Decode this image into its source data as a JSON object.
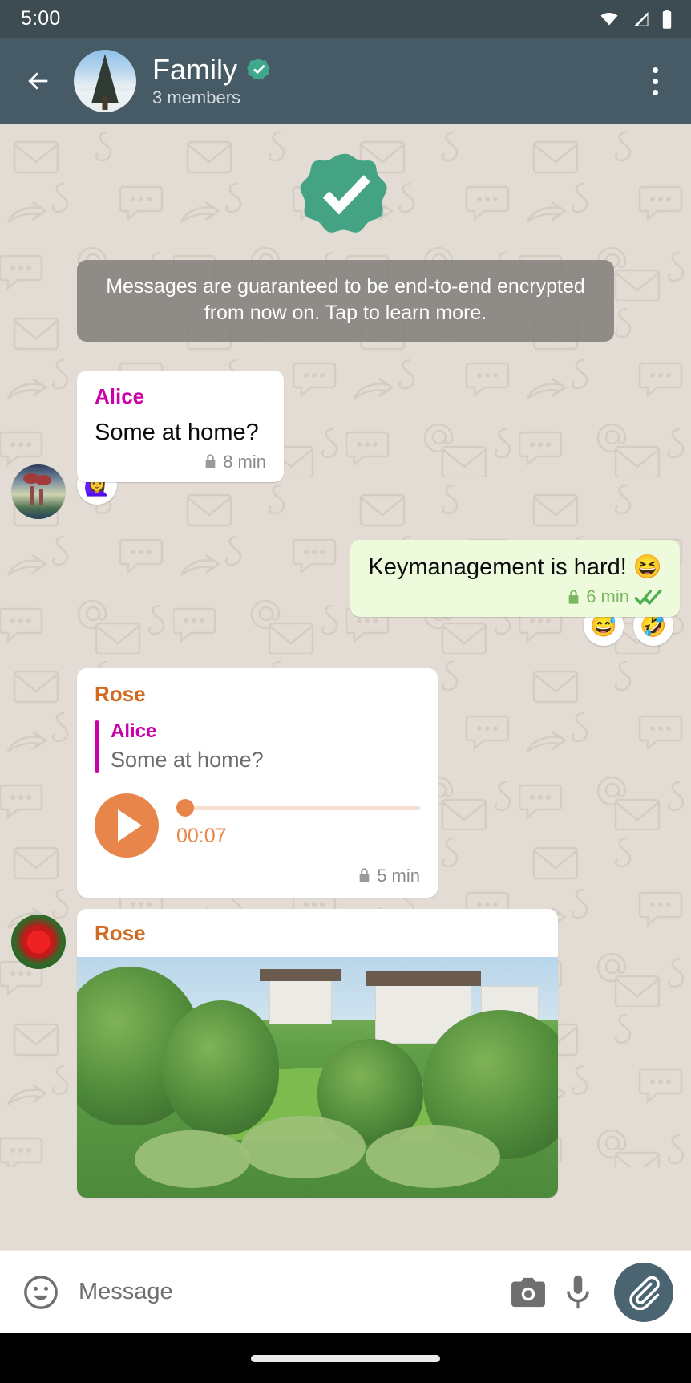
{
  "status_bar": {
    "time": "5:00",
    "icons": [
      "wifi-icon",
      "cellular-signal-icon",
      "battery-icon"
    ]
  },
  "app_bar": {
    "back_icon": "back-arrow-icon",
    "avatar": "group-avatar-snowy-tree",
    "title": "Family",
    "verified_icon": "verified-badge-icon",
    "subtitle": "3 members",
    "overflow_icon": "more-vertical-icon",
    "background_color": "#465b66"
  },
  "encryption_notice": {
    "badge_icon": "verified-shield-check-icon",
    "text": "Messages are guaranteed to be end-to-end encrypted from now on. Tap to learn more.",
    "badge_color": "#44a383"
  },
  "colors": {
    "chat_background": "#e2dcd4",
    "incoming_bubble": "#ffffff",
    "outgoing_bubble": "#eefadc",
    "alice_name": "#cc00a8",
    "rose_name": "#d2691e",
    "audio_accent": "#e8854a",
    "outgoing_meta": "#7bb661"
  },
  "messages": [
    {
      "id": "msg-alice-text",
      "direction": "incoming",
      "sender": "Alice",
      "avatar": "alice-avatar-tree-painting",
      "text": "Some at home?",
      "lock_icon": "lock-icon",
      "timestamp": "8 min",
      "reactions": [
        "🙋‍♀️"
      ]
    },
    {
      "id": "msg-outgoing-text",
      "direction": "outgoing",
      "text": "Keymanagement is hard! 😆",
      "lock_icon": "lock-icon",
      "timestamp": "6 min",
      "status_icon": "double-check-icon",
      "reactions": [
        "😅",
        "🤣"
      ]
    },
    {
      "id": "msg-rose-voice",
      "direction": "incoming",
      "sender": "Rose",
      "avatar": "rose-avatar-red-flower",
      "quote": {
        "name": "Alice",
        "text": "Some at home?"
      },
      "play_icon": "play-icon",
      "position_time": "00:07",
      "progress_percent": 0,
      "lock_icon": "lock-icon",
      "timestamp": "5 min"
    },
    {
      "id": "msg-rose-photo",
      "direction": "incoming",
      "sender": "Rose",
      "attachment": "photo-garden-houses"
    }
  ],
  "input_bar": {
    "emoji_icon": "emoji-smiley-icon",
    "placeholder": "Message",
    "camera_icon": "camera-icon",
    "mic_icon": "microphone-icon",
    "attach_icon": "paperclip-icon",
    "attach_button_color": "#4a6472"
  },
  "nav_bar": {
    "gesture_pill": "home-gesture-pill"
  }
}
